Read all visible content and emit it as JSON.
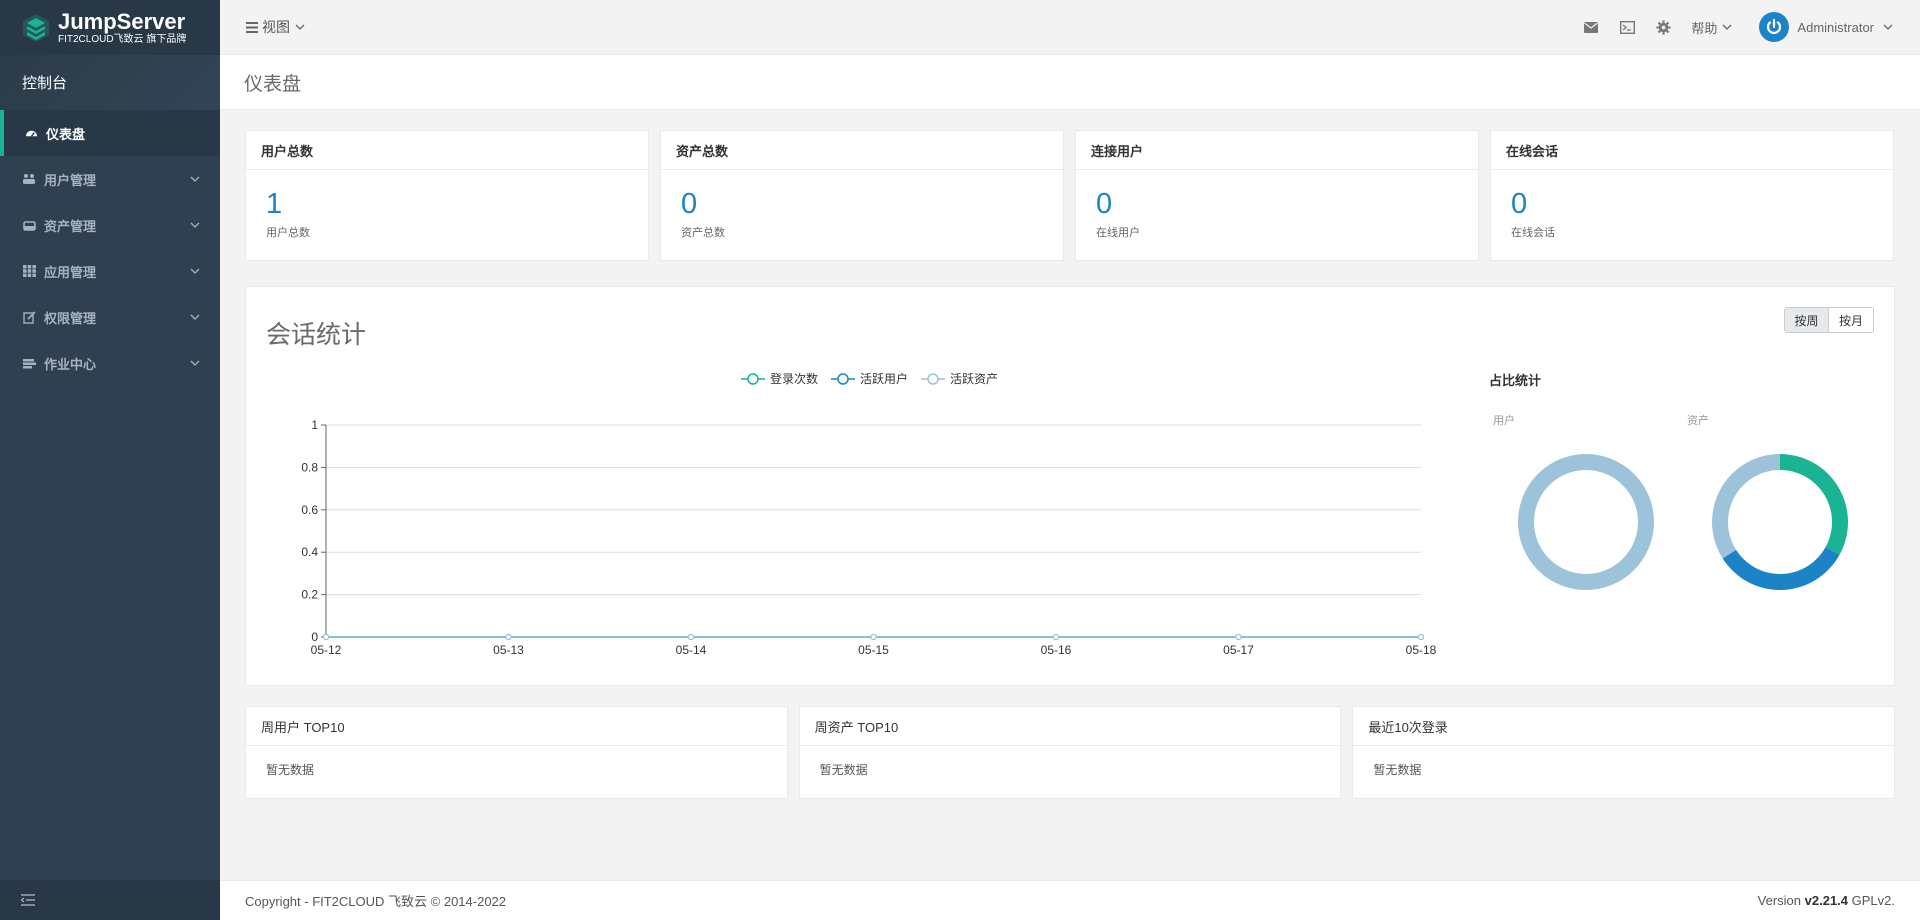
{
  "brand": {
    "name": "JumpServer",
    "sub": "FIT2CLOUD飞致云 旗下品牌"
  },
  "sidebar": {
    "console": "控制台",
    "items": [
      {
        "label": "仪表盘",
        "icon": "dashboard-icon",
        "active": true
      },
      {
        "label": "用户管理",
        "icon": "users-icon"
      },
      {
        "label": "资产管理",
        "icon": "inbox-icon"
      },
      {
        "label": "应用管理",
        "icon": "grid-icon"
      },
      {
        "label": "权限管理",
        "icon": "edit-icon"
      },
      {
        "label": "作业中心",
        "icon": "terminal-icon"
      }
    ]
  },
  "topbar": {
    "view": "视图",
    "help": "帮助",
    "user": "Administrator"
  },
  "page": {
    "title": "仪表盘"
  },
  "stats": [
    {
      "title": "用户总数",
      "value": "1",
      "label": "用户总数"
    },
    {
      "title": "资产总数",
      "value": "0",
      "label": "资产总数"
    },
    {
      "title": "连接用户",
      "value": "0",
      "label": "在线用户"
    },
    {
      "title": "在线会话",
      "value": "0",
      "label": "在线会话"
    }
  ],
  "session": {
    "title": "会话统计",
    "period_week": "按周",
    "period_month": "按月",
    "ratio_title": "占比统计",
    "donut_user_label": "用户",
    "donut_asset_label": "资产"
  },
  "chart_data": [
    {
      "type": "line",
      "x": [
        "05-12",
        "05-13",
        "05-14",
        "05-15",
        "05-16",
        "05-17",
        "05-18"
      ],
      "series": [
        {
          "name": "登录次数",
          "values": [
            0,
            0,
            0,
            0,
            0,
            0,
            0
          ],
          "color": "#1ab394"
        },
        {
          "name": "活跃用户",
          "values": [
            0,
            0,
            0,
            0,
            0,
            0,
            0
          ],
          "color": "#1c84c6"
        },
        {
          "name": "活跃资产",
          "values": [
            0,
            0,
            0,
            0,
            0,
            0,
            0
          ],
          "color": "#9cc3da"
        }
      ],
      "ylim": [
        0,
        1
      ],
      "yticks": [
        "0",
        "0.2",
        "0.4",
        "0.6",
        "0.8",
        "1"
      ],
      "grid": true,
      "legend": "top-center"
    },
    {
      "type": "pie",
      "title": "用户",
      "donut": true,
      "slices": [
        {
          "value": 1,
          "color": "#9cc3da"
        }
      ]
    },
    {
      "type": "pie",
      "title": "资产",
      "donut": true,
      "slices": [
        {
          "value": 0.33,
          "color": "#1ab394"
        },
        {
          "value": 0.33,
          "color": "#1c84c6"
        },
        {
          "value": 0.34,
          "color": "#9cc3da"
        }
      ]
    }
  ],
  "top10": [
    {
      "title": "周用户 TOP10",
      "empty": "暂无数据"
    },
    {
      "title": "周资产 TOP10",
      "empty": "暂无数据"
    },
    {
      "title": "最近10次登录",
      "empty": "暂无数据"
    }
  ],
  "footer": {
    "copyright": "Copyright - FIT2CLOUD 飞致云 © 2014-2022",
    "version_prefix": "Version",
    "version": "v2.21.4",
    "license": "GPLv2."
  }
}
